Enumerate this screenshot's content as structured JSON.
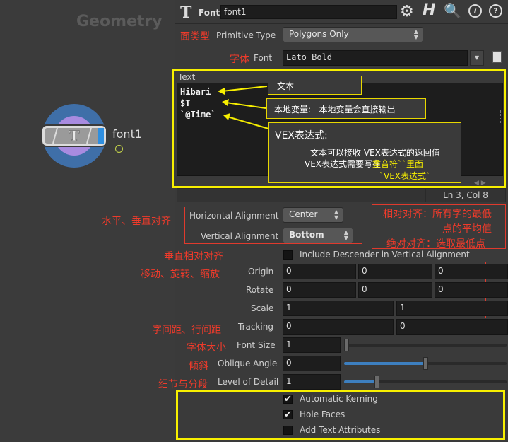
{
  "network": {
    "context_label": "Geometry",
    "node_name": "font1",
    "node_icon_letter": "T"
  },
  "header": {
    "node_type": "Font",
    "node_name_value": "font1"
  },
  "params": {
    "primitive_type": {
      "label": "Primitive Type",
      "value": "Polygons Only"
    },
    "font": {
      "label": "Font",
      "value": "Lato Bold"
    },
    "text": {
      "label": "Text",
      "lines": [
        "Hibari",
        "$T",
        "`@Time`"
      ],
      "status": "Ln 3, Col 8"
    },
    "halign": {
      "label": "Horizontal Alignment",
      "value": "Center"
    },
    "valign": {
      "label": "Vertical Alignment",
      "value": "Bottom"
    },
    "include_descender": {
      "label": "Include Descender in Vertical Alignment",
      "checked": false
    },
    "origin": {
      "label": "Origin",
      "values": [
        "0",
        "0",
        "0"
      ]
    },
    "rotate": {
      "label": "Rotate",
      "values": [
        "0",
        "0",
        "0"
      ]
    },
    "scale": {
      "label": "Scale",
      "values": [
        "1",
        "1"
      ]
    },
    "tracking": {
      "label": "Tracking",
      "values": [
        "0",
        "0"
      ]
    },
    "font_size": {
      "label": "Font Size",
      "value": "1",
      "slider_fraction": 0.0
    },
    "oblique_angle": {
      "label": "Oblique Angle",
      "value": "0",
      "slider_fraction": 0.5
    },
    "level_of_detail": {
      "label": "Level of Detail",
      "value": "1",
      "slider_fraction": 0.2
    },
    "automatic_kerning": {
      "label": "Automatic Kerning",
      "checked": true
    },
    "hole_faces": {
      "label": "Hole Faces",
      "checked": true
    },
    "add_text_attributes": {
      "label": "Add Text Attributes",
      "checked": false
    }
  },
  "annotations": {
    "primitive_type": "面类型",
    "font": "字体",
    "text_note": "文本",
    "local_var_title": "本地变量:",
    "local_var_body": "本地变量会直接输出",
    "vex_title": "VEX表达式:",
    "vex_line1": "文本可以接收 VEX表达式的返回值",
    "vex_line2a": "VEX表达式需要写在",
    "vex_line2b": "重音符``里面",
    "vex_line3": "`VEX表达式`",
    "align": "水平、垂直对齐",
    "align_note1a": "相对对齐：所有字的最低",
    "align_note1b": "点的平均值",
    "align_note2": "绝对对齐：选取最低点",
    "vertical_relative": "垂直相对对齐",
    "transform": "移动、旋转、缩放",
    "spacing": "字间距、行间距",
    "font_size": "字体大小",
    "oblique": "倾斜",
    "detail": "细节与分段"
  },
  "colors": {
    "accent": "#f7ef00",
    "annotation_red": "#ee3b2b",
    "slider_blue": "#3d7fbf",
    "node_blue": "#3f6fa8",
    "node_purple": "#a88be0"
  }
}
